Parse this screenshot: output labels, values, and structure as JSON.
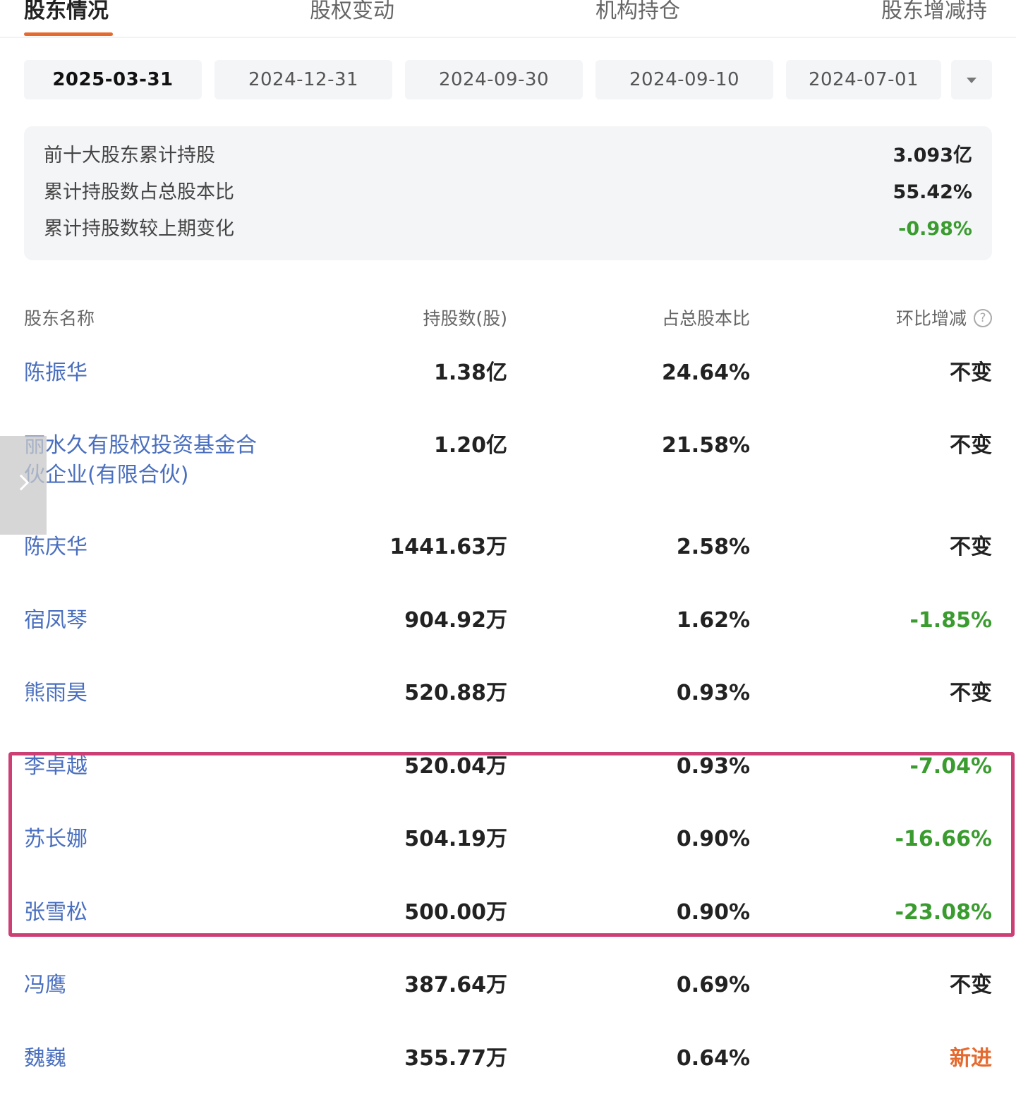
{
  "tabs": [
    {
      "label": "股东情况",
      "active": true
    },
    {
      "label": "股权变动",
      "active": false
    },
    {
      "label": "机构持仓",
      "active": false
    },
    {
      "label": "股东增减持",
      "active": false
    }
  ],
  "dates": [
    "2025-03-31",
    "2024-12-31",
    "2024-09-30",
    "2024-09-10",
    "2024-07-01"
  ],
  "selected_date": "2025-03-31",
  "summary": [
    {
      "label": "前十大股东累计持股",
      "value": "3.093亿"
    },
    {
      "label": "累计持股数占总股本比",
      "value": "55.42%"
    },
    {
      "label": "累计持股数较上期变化",
      "value": "-0.98%"
    }
  ],
  "table": {
    "headers": {
      "name": "股东名称",
      "shares": "持股数(股)",
      "pct": "占总股本比",
      "change": "环比增减",
      "help": "?"
    },
    "rows": [
      {
        "name": "陈振华",
        "shares": "1.38亿",
        "pct": "24.64%",
        "change": "不变"
      },
      {
        "name": "丽水久有股权投资基金合伙企业(有限合伙)",
        "shares": "1.20亿",
        "pct": "21.58%",
        "change": "不变"
      },
      {
        "name": "陈庆华",
        "shares": "1441.63万",
        "pct": "2.58%",
        "change": "不变"
      },
      {
        "name": "宿凤琴",
        "shares": "904.92万",
        "pct": "1.62%",
        "change": "-1.85%"
      },
      {
        "name": "熊雨昊",
        "shares": "520.88万",
        "pct": "0.93%",
        "change": "不变"
      },
      {
        "name": "李卓越",
        "shares": "520.04万",
        "pct": "0.93%",
        "change": "-7.04%"
      },
      {
        "name": "苏长娜",
        "shares": "504.19万",
        "pct": "0.90%",
        "change": "-16.66%"
      },
      {
        "name": "张雪松",
        "shares": "500.00万",
        "pct": "0.90%",
        "change": "-23.08%"
      },
      {
        "name": "冯鹰",
        "shares": "387.64万",
        "pct": "0.69%",
        "change": "不变"
      },
      {
        "name": "魏巍",
        "shares": "355.77万",
        "pct": "0.64%",
        "change": "新进"
      }
    ]
  },
  "colors": {
    "accent": "#e56a2f",
    "negative": "#3a9c2f",
    "link": "#4a6fbf",
    "highlight": "#cc3f74"
  }
}
